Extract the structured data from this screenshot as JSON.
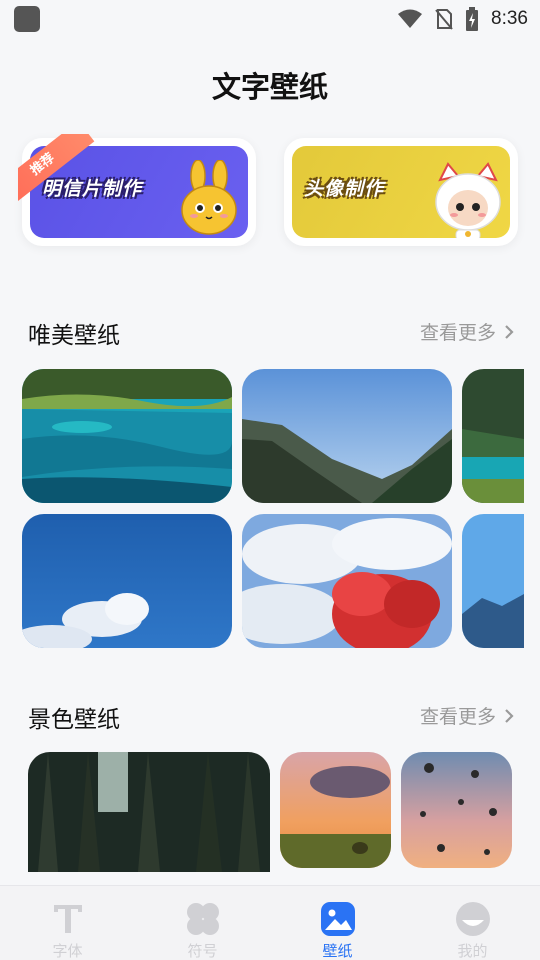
{
  "status_bar": {
    "time": "8:36",
    "icons": [
      "app-icon",
      "wifi-icon",
      "no-sim-icon",
      "battery-charging-icon"
    ]
  },
  "page_title": "文字壁纸",
  "promos": [
    {
      "label": "明信片制作",
      "badge": "推荐",
      "color": "#5a52e6",
      "icon": "bunny-mascot-icon"
    },
    {
      "label": "头像制作",
      "color": "#e3c93a",
      "icon": "cat-mascot-icon"
    }
  ],
  "sections": [
    {
      "title": "唯美壁纸",
      "more": "查看更多"
    },
    {
      "title": "景色壁纸",
      "more": "查看更多"
    }
  ],
  "tabs": [
    {
      "label": "字体",
      "icon": "font-t-icon",
      "active": false
    },
    {
      "label": "符号",
      "icon": "clover-icon",
      "active": false
    },
    {
      "label": "壁纸",
      "icon": "image-icon",
      "active": true
    },
    {
      "label": "我的",
      "icon": "profile-icon",
      "active": false
    }
  ],
  "colors": {
    "accent": "#2a73f4",
    "background": "#f6f7f9",
    "inactive_tab": "#d0d0d4"
  }
}
